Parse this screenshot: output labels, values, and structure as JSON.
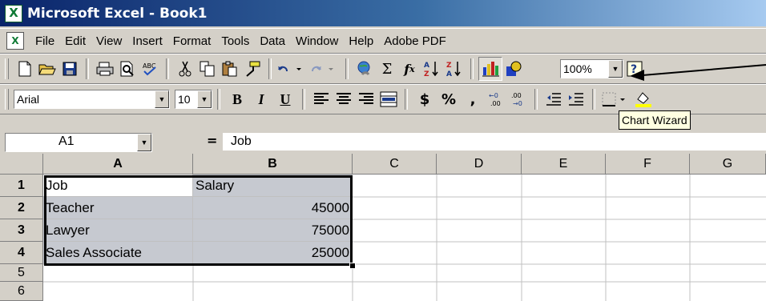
{
  "window": {
    "title": "Microsoft Excel - Book1"
  },
  "menu": [
    "File",
    "Edit",
    "View",
    "Insert",
    "Format",
    "Tools",
    "Data",
    "Window",
    "Help",
    "Adobe PDF"
  ],
  "standard_toolbar": {
    "zoom": "100%",
    "icons": [
      "new-icon",
      "open-icon",
      "save-icon",
      "print-icon",
      "print-preview-icon",
      "spelling-icon",
      "cut-icon",
      "copy-icon",
      "paste-icon",
      "format-painter-icon",
      "undo-icon",
      "redo-icon",
      "hyperlink-icon",
      "autosum-icon",
      "function-icon",
      "sort-ascending-icon",
      "sort-descending-icon",
      "chart-wizard-icon",
      "drawing-icon",
      "help-icon"
    ]
  },
  "format_toolbar": {
    "font": "Arial",
    "size": "10",
    "bold": "B",
    "italic": "I",
    "underline": "U",
    "currency": "$",
    "percent": "%",
    "comma": ","
  },
  "tooltip": "Chart Wizard",
  "formula_bar": {
    "name_box": "A1",
    "equals": "=",
    "content": "Job"
  },
  "sheet": {
    "columns": [
      "A",
      "B",
      "C",
      "D",
      "E",
      "F",
      "G"
    ],
    "rows": [
      "1",
      "2",
      "3",
      "4",
      "5",
      "6"
    ],
    "cells": [
      [
        "Job",
        "Salary"
      ],
      [
        "Teacher",
        "45000"
      ],
      [
        "Lawyer",
        "75000"
      ],
      [
        "Sales Associate",
        "25000"
      ]
    ]
  }
}
